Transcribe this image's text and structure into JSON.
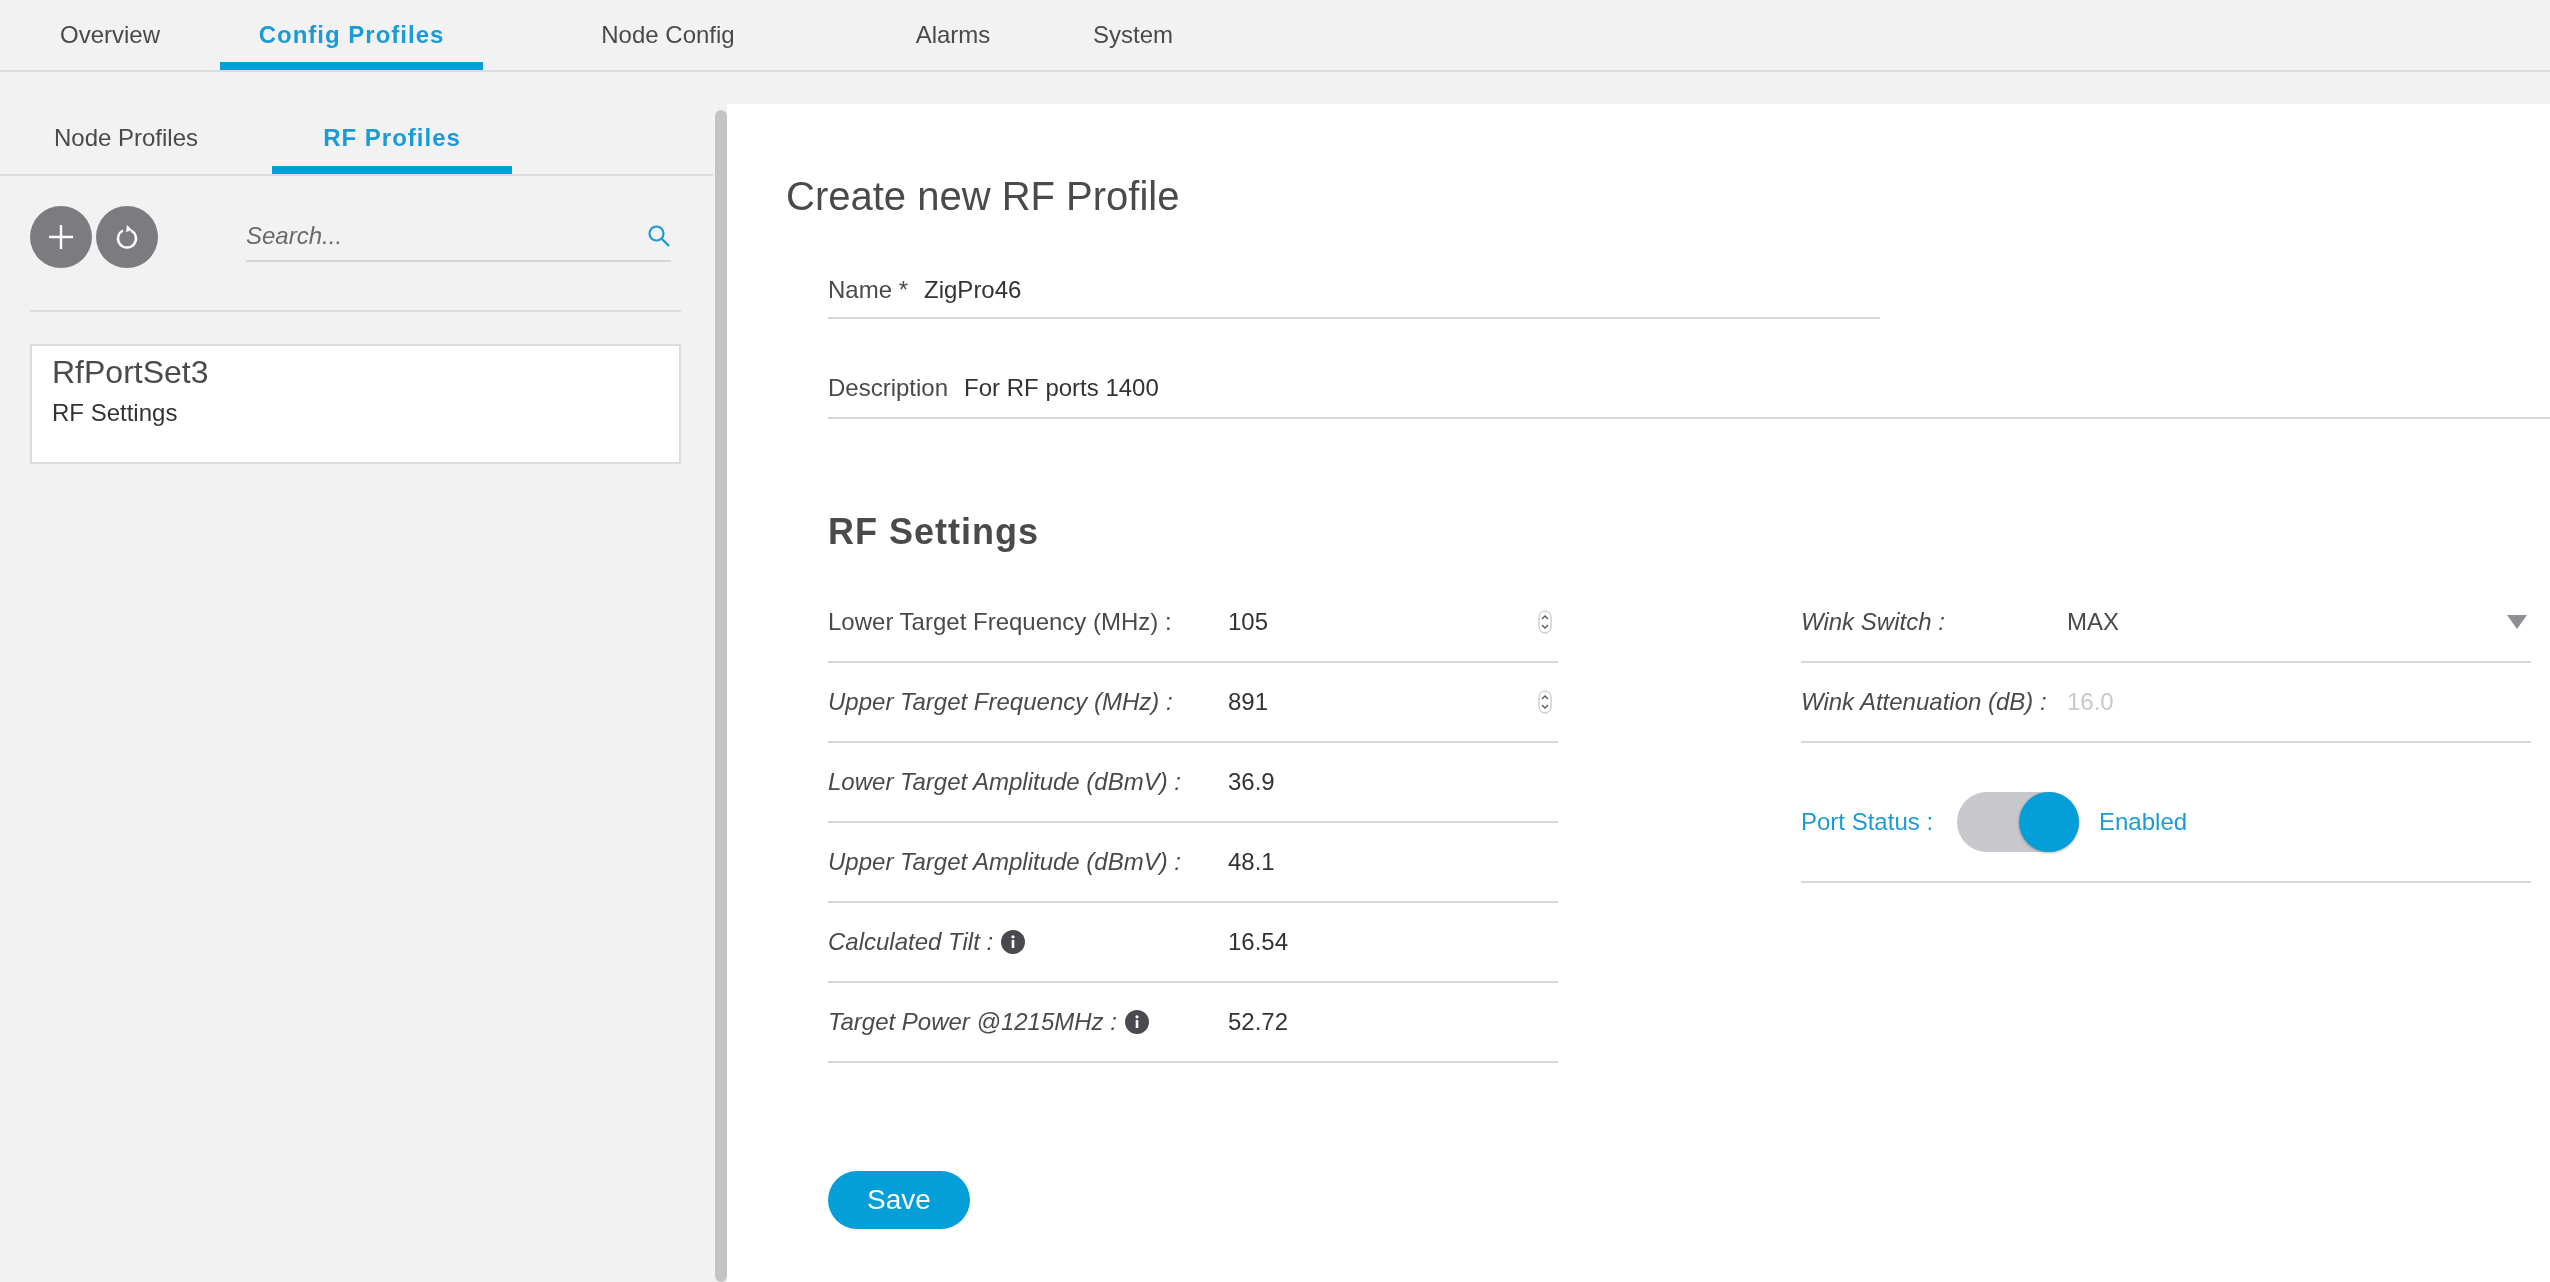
{
  "nav_tabs": [
    {
      "label": "Overview",
      "selected": false
    },
    {
      "label": "Config Profiles",
      "selected": true
    },
    {
      "label": "Node Config",
      "selected": false
    },
    {
      "label": "Alarms",
      "selected": false
    },
    {
      "label": "System",
      "selected": false
    }
  ],
  "sub_tabs": [
    {
      "label": "Node Profiles",
      "selected": false
    },
    {
      "label": "RF Profiles",
      "selected": true
    }
  ],
  "search": {
    "placeholder": "Search..."
  },
  "profiles": [
    {
      "name": "RfPortSet3",
      "subtitle": "RF Settings"
    }
  ],
  "form": {
    "title": "Create new RF Profile",
    "name": {
      "label": "Name *",
      "value": "ZigPro46"
    },
    "description": {
      "label": "Description",
      "value": "For RF ports 1400"
    },
    "section_title": "RF Settings",
    "left_fields": [
      {
        "kind": "number",
        "label": "Lower Target Frequency (MHz) :",
        "value": "105",
        "italic": false,
        "info": false
      },
      {
        "kind": "number",
        "label": "Upper Target Frequency (MHz) :",
        "value": "891",
        "italic": true,
        "info": false
      },
      {
        "kind": "text",
        "label": "Lower Target Amplitude (dBmV) :",
        "value": "36.9",
        "italic": true,
        "info": false
      },
      {
        "kind": "text",
        "label": "Upper Target Amplitude (dBmV) :",
        "value": "48.1",
        "italic": true,
        "info": false
      },
      {
        "kind": "text",
        "label": "Calculated Tilt :",
        "value": "16.54",
        "italic": true,
        "info": true
      },
      {
        "kind": "text",
        "label": "Target Power @1215MHz :",
        "value": "52.72",
        "italic": true,
        "info": true
      }
    ],
    "right_fields": [
      {
        "kind": "select",
        "label": "Wink Switch :",
        "value": "MAX"
      },
      {
        "kind": "text",
        "label": "Wink Attenuation (dB) :",
        "placeholder": "16.0"
      },
      {
        "kind": "toggle",
        "label": "Port Status :",
        "on": true,
        "state_text": "Enabled"
      }
    ],
    "save_button": "Save"
  }
}
